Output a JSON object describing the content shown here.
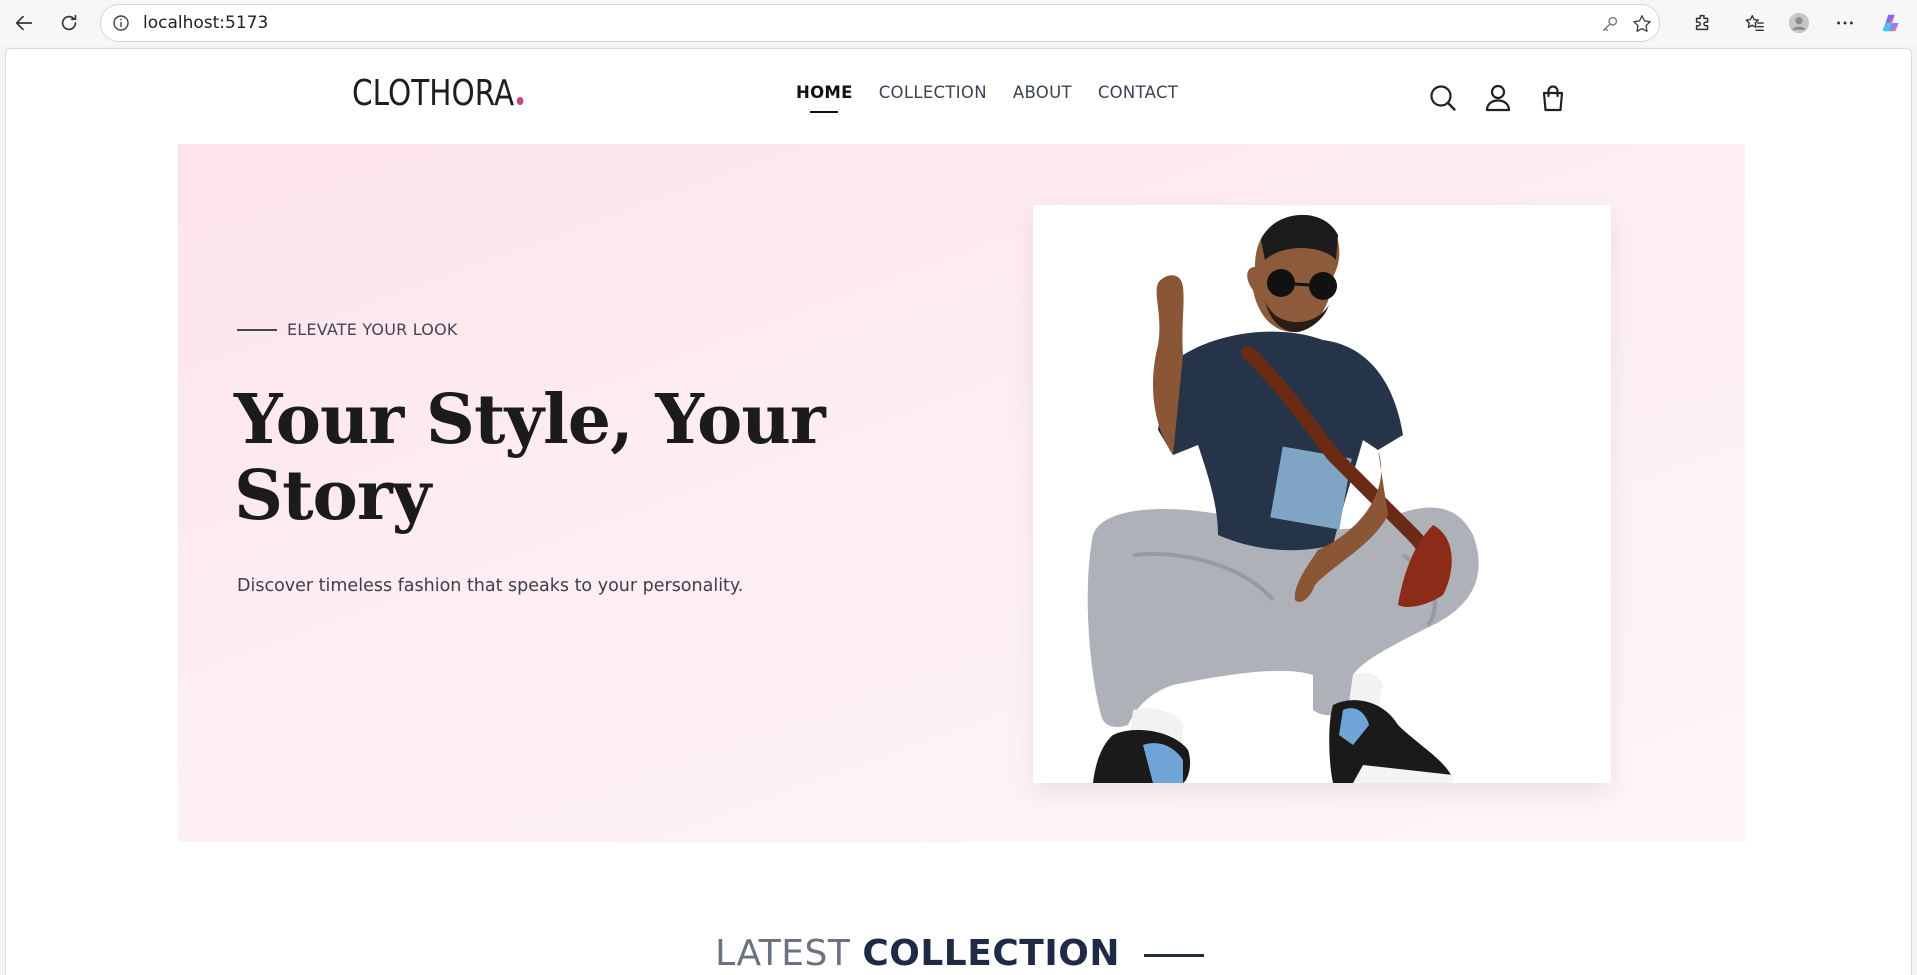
{
  "browser": {
    "url": "localhost:5173",
    "icons": [
      "back-icon",
      "reload-icon",
      "info-icon",
      "key-icon",
      "star-icon",
      "extensions-icon",
      "favorites-icon",
      "profile-icon",
      "more-icon",
      "copilot-icon"
    ]
  },
  "nav": {
    "logo": "CLOTHORA",
    "links": [
      {
        "label": "HOME",
        "active": true
      },
      {
        "label": "COLLECTION",
        "active": false
      },
      {
        "label": "ABOUT",
        "active": false
      },
      {
        "label": "CONTACT",
        "active": false
      }
    ],
    "icons": [
      "search-icon",
      "user-icon",
      "bag-icon"
    ]
  },
  "hero": {
    "eyebrow": "ELEVATE YOUR LOOK",
    "headline_line1": "Your Style, Your",
    "headline_line2": "Story",
    "subtext": "Discover timeless fashion that speaks to your personality.",
    "image": "hero-model-image"
  },
  "section": {
    "title_light": "LATEST",
    "title_bold": "COLLECTION"
  },
  "colors": {
    "accent": "#c2477f",
    "hero_bg": "#fde3ea",
    "dark_text": "#1b1b1b",
    "title_dark": "#1f2a44"
  }
}
